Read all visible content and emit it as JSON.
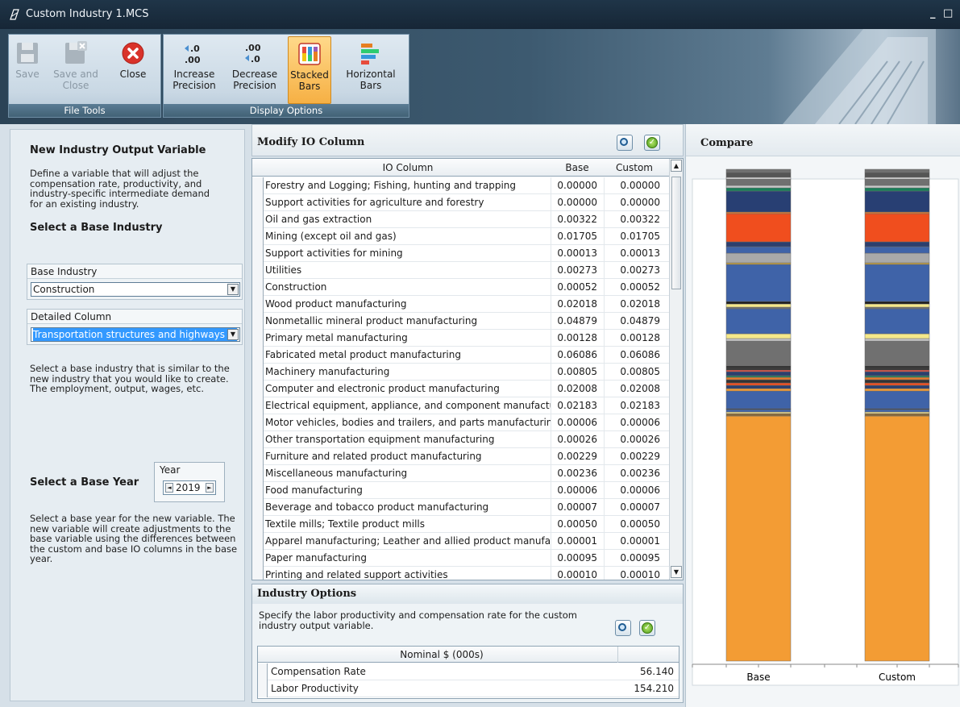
{
  "window": {
    "title": "Custom Industry 1.MCS",
    "controls": [
      "_",
      "□"
    ]
  },
  "ribbon": {
    "file_tools": {
      "label": "File Tools",
      "buttons": [
        {
          "label": "Save",
          "icon": "save-icon",
          "enabled": false
        },
        {
          "label": "Save and Close",
          "icon": "save-close-icon",
          "enabled": false
        },
        {
          "label": "Close",
          "icon": "close-icon",
          "enabled": true
        }
      ]
    },
    "display_options": {
      "label": "Display Options",
      "buttons": [
        {
          "label": "Increase Precision",
          "icon": "increase-precision-icon"
        },
        {
          "label": "Decrease Precision",
          "icon": "decrease-precision-icon"
        },
        {
          "label": "Stacked Bars",
          "icon": "stacked-bars-icon",
          "active": true
        },
        {
          "label": "Horizontal Bars",
          "icon": "horizontal-bars-icon"
        }
      ]
    }
  },
  "left": {
    "heading": "New Industry Output Variable",
    "description": "Define a variable that will adjust the compensation rate, productivity, and industry-specific intermediate demand for an existing industry.",
    "base_industry_heading": "Select a Base Industry",
    "base_industry_label": "Base Industry",
    "base_industry_value": "Construction",
    "detailed_column_label": "Detailed Column",
    "detailed_column_value": "Transportation structures and highways a",
    "base_industry_help": "Select a base industry that is similar to the new industry that you would like to create. The employment, output, wages, etc.",
    "year_heading": "Select a Base Year",
    "year_label": "Year",
    "year_value": "2019",
    "year_help": "Select a base year for the new variable. The new variable will create adjustments to the base variable using the differences between the custom and base IO columns in the base year."
  },
  "io": {
    "title": "Modify IO Column",
    "headers": {
      "name": "IO Column",
      "base": "Base",
      "custom": "Custom"
    },
    "rows": [
      {
        "name": "Forestry and Logging; Fishing, hunting and trapping",
        "base": "0.00000",
        "custom": "0.00000"
      },
      {
        "name": "Support activities for agriculture and forestry",
        "base": "0.00000",
        "custom": "0.00000"
      },
      {
        "name": "Oil and gas extraction",
        "base": "0.00322",
        "custom": "0.00322"
      },
      {
        "name": "Mining (except oil and gas)",
        "base": "0.01705",
        "custom": "0.01705"
      },
      {
        "name": "Support activities for mining",
        "base": "0.00013",
        "custom": "0.00013"
      },
      {
        "name": "Utilities",
        "base": "0.00273",
        "custom": "0.00273"
      },
      {
        "name": "Construction",
        "base": "0.00052",
        "custom": "0.00052"
      },
      {
        "name": "Wood product manufacturing",
        "base": "0.02018",
        "custom": "0.02018"
      },
      {
        "name": "Nonmetallic mineral product manufacturing",
        "base": "0.04879",
        "custom": "0.04879"
      },
      {
        "name": "Primary metal manufacturing",
        "base": "0.00128",
        "custom": "0.00128"
      },
      {
        "name": "Fabricated metal product manufacturing",
        "base": "0.06086",
        "custom": "0.06086"
      },
      {
        "name": "Machinery manufacturing",
        "base": "0.00805",
        "custom": "0.00805"
      },
      {
        "name": "Computer and electronic product manufacturing",
        "base": "0.02008",
        "custom": "0.02008"
      },
      {
        "name": "Electrical equipment, appliance, and component manufacturir",
        "base": "0.02183",
        "custom": "0.02183"
      },
      {
        "name": "Motor vehicles, bodies and trailers, and parts manufacturing",
        "base": "0.00006",
        "custom": "0.00006"
      },
      {
        "name": "Other transportation equipment manufacturing",
        "base": "0.00026",
        "custom": "0.00026"
      },
      {
        "name": "Furniture and related product manufacturing",
        "base": "0.00229",
        "custom": "0.00229"
      },
      {
        "name": "Miscellaneous manufacturing",
        "base": "0.00236",
        "custom": "0.00236"
      },
      {
        "name": "Food manufacturing",
        "base": "0.00006",
        "custom": "0.00006"
      },
      {
        "name": "Beverage and tobacco product manufacturing",
        "base": "0.00007",
        "custom": "0.00007"
      },
      {
        "name": "Textile mills; Textile product mills",
        "base": "0.00050",
        "custom": "0.00050"
      },
      {
        "name": "Apparel manufacturing; Leather and allied product manufactu",
        "base": "0.00001",
        "custom": "0.00001"
      },
      {
        "name": "Paper manufacturing",
        "base": "0.00095",
        "custom": "0.00095"
      },
      {
        "name": "Printing and related support activities",
        "base": "0.00010",
        "custom": "0.00010"
      }
    ]
  },
  "options": {
    "title": "Industry Options",
    "description": "Specify the labor productivity and compensation rate for the custom industry output variable.",
    "header": "Nominal $ (000s)",
    "rows": [
      {
        "label": "Compensation Rate",
        "value": "56.140"
      },
      {
        "label": "Labor Productivity",
        "value": "154.210"
      }
    ]
  },
  "compare": {
    "title": "Compare",
    "chart_data": {
      "type": "bar",
      "stacked": true,
      "categories": [
        "Base",
        "Custom"
      ],
      "segments_colors": [
        "#f39c34",
        "#8b6a3a",
        "#f39c34",
        "#3f63a8",
        "#333333",
        "#f06a1e",
        "#3f63a8",
        "#2f4f8a",
        "#1e7f5c",
        "#707070",
        "#f5e88a",
        "#c9c9c9",
        "#3f63a8",
        "#f5e88a",
        "#a9a9a9",
        "#3f63a8",
        "#f04e1e",
        "#283f73",
        "#1a7f5a",
        "#707070"
      ]
    }
  }
}
